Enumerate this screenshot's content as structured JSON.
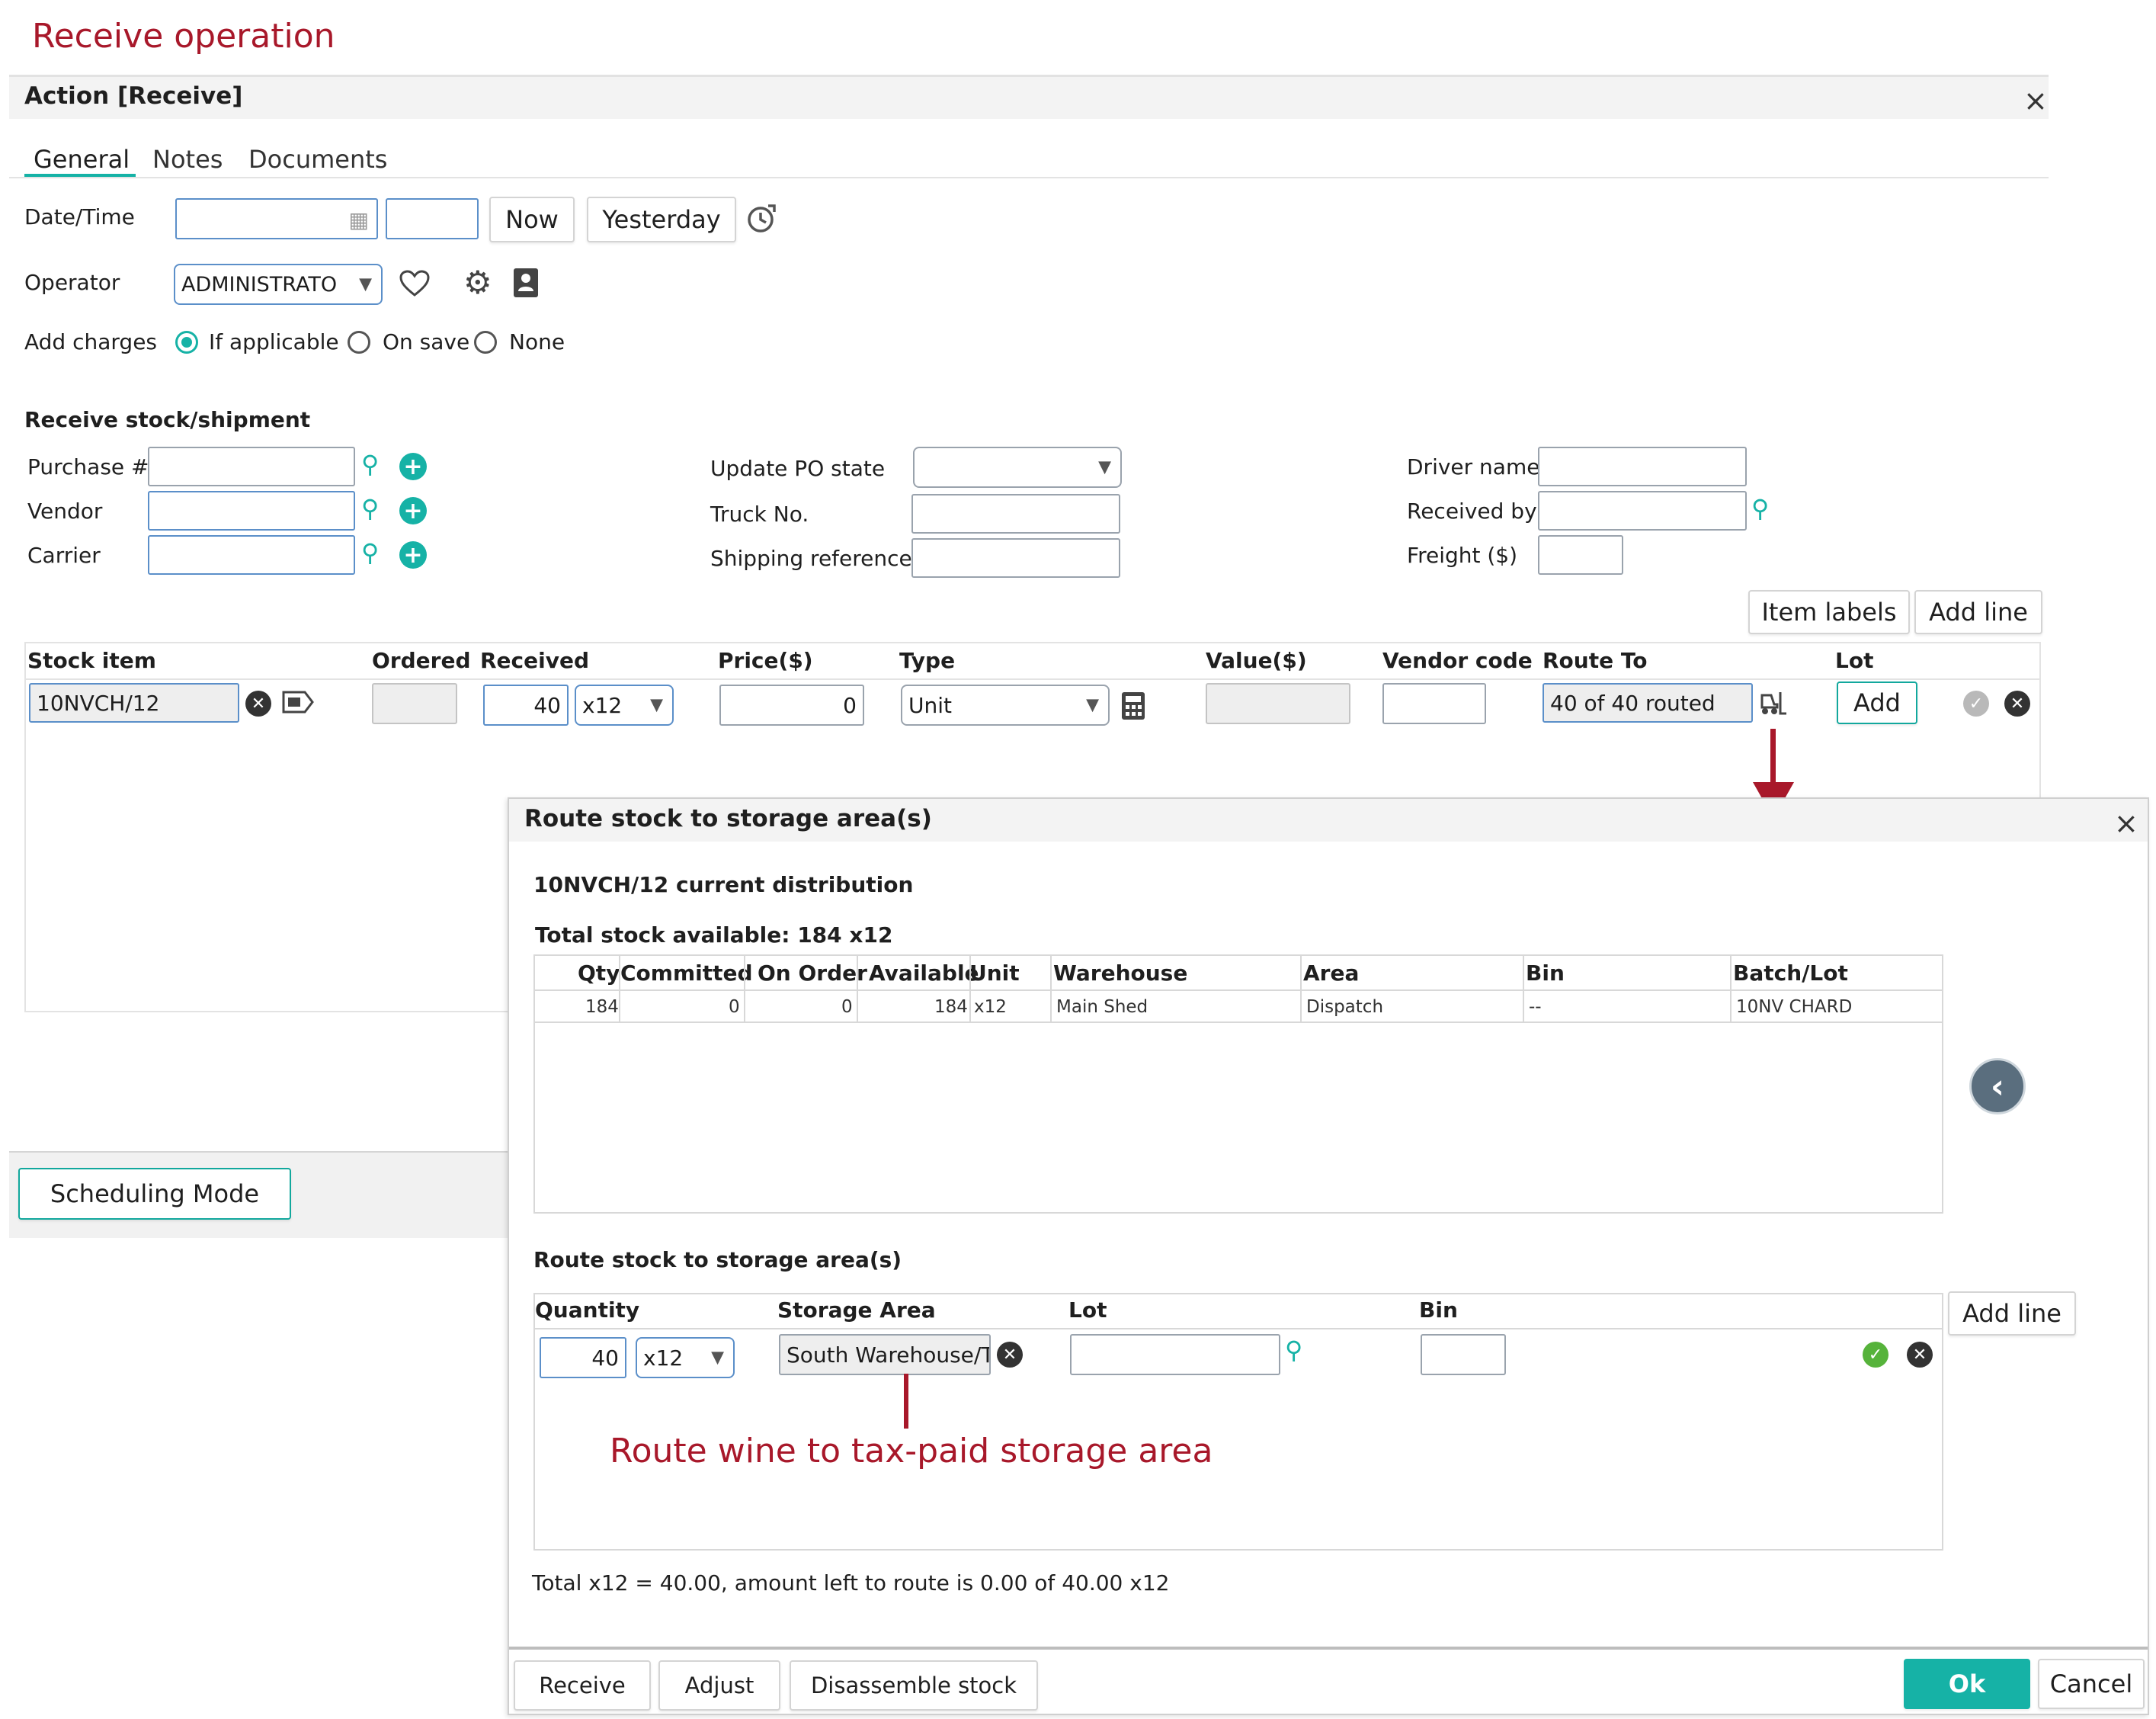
{
  "page_title": "Receive operation",
  "dialog": {
    "title": "Action [Receive]",
    "close": "×",
    "tabs": [
      "General",
      "Notes",
      "Documents"
    ],
    "datetime_label": "Date/Time",
    "now_label": "Now",
    "yesterday_label": "Yesterday",
    "operator_label": "Operator",
    "operator_value": "ADMINISTRATO",
    "add_charges_label": "Add charges",
    "charges_options": [
      "If applicable",
      "On save",
      "None"
    ],
    "charges_selected": "If applicable",
    "receive_section": "Receive stock/shipment",
    "purchase_label": "Purchase #",
    "vendor_label": "Vendor",
    "carrier_label": "Carrier",
    "update_po_label": "Update PO state",
    "truck_label": "Truck No.",
    "shipping_label": "Shipping reference",
    "driver_label": "Driver name",
    "received_by_label": "Received by",
    "freight_label": "Freight ($)",
    "item_labels_btn": "Item labels",
    "add_line_btn": "Add line",
    "scheduling_btn": "Scheduling Mode"
  },
  "line_table": {
    "headers": [
      "Stock item",
      "Ordered",
      "Received",
      "Price($)",
      "Type",
      "Value($)",
      "Vendor code",
      "Route To",
      "Lot"
    ],
    "row": {
      "stock_item": "10NVCH/12",
      "received": "40",
      "received_unit": "x12",
      "price": "0",
      "type": "Unit",
      "route_to": "40 of 40 routed",
      "lot_btn": "Add"
    }
  },
  "route_panel": {
    "title": "Route stock to storage area(s)",
    "close": "×",
    "distribution_title": "10NVCH/12 current distribution",
    "total_available": "Total stock available: 184 x12",
    "dist_headers": [
      "Qty",
      "Committed",
      "On Order",
      "Available",
      "Unit",
      "Warehouse",
      "Area",
      "Bin",
      "Batch/Lot"
    ],
    "dist_rows": [
      [
        "184",
        "0",
        "0",
        "184",
        "x12",
        "Main Shed",
        "Dispatch",
        "--",
        "10NV CHARD"
      ]
    ],
    "route_section": "Route stock to storage area(s)",
    "route_headers": [
      "Quantity",
      "Storage Area",
      "Lot",
      "Bin"
    ],
    "route_row": {
      "quantity": "40",
      "unit": "x12",
      "storage_area": "South Warehouse/T"
    },
    "add_line_btn": "Add line",
    "total_text": "Total x12 = 40.00, amount left to route is 0.00 of 40.00 x12",
    "buttons": {
      "receive": "Receive",
      "adjust": "Adjust",
      "disassemble": "Disassemble stock",
      "ok": "Ok",
      "cancel": "Cancel"
    }
  },
  "annotation": "Route wine to tax-paid storage area",
  "colors": {
    "accent": "#16b2a6",
    "annotation": "#a8182a",
    "title": "#a8182a"
  }
}
